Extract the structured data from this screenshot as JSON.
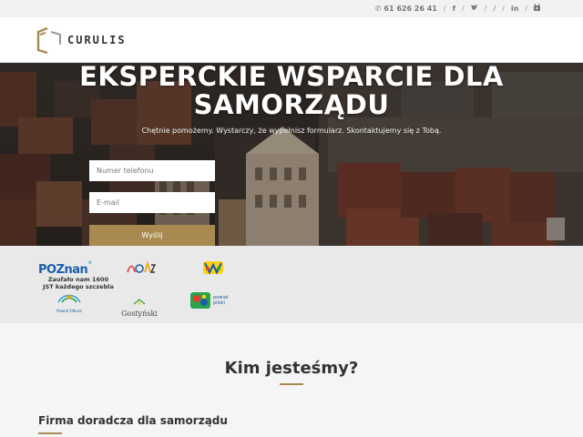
{
  "topbar": {
    "phone": "61 626 26 41",
    "separator": "/",
    "social": [
      {
        "icon": "facebook-icon",
        "glyph": "f"
      },
      {
        "icon": "twitter-icon",
        "glyph": "t"
      },
      {
        "icon": "google-plus-icon",
        "glyph": "/"
      },
      {
        "icon": "linkedin-icon",
        "glyph": "in"
      },
      {
        "icon": "youtube-icon",
        "glyph": "▶"
      }
    ]
  },
  "header": {
    "logo_text": "CURULIS"
  },
  "hero": {
    "title_line1": "EKSPERCKIE WSPARCIE DLA",
    "title_line2": "SAMORZĄDU",
    "subtitle": "Chętnie pomożemy. Wystarczy, że wypełnisz formularz. Skontaktujemy się z Tobą.",
    "phone_placeholder": "Numer telefonu",
    "email_placeholder": "E-mail",
    "send_label": "Wyślij"
  },
  "partners": {
    "poznan_logo": "POZnan",
    "trust_line1": "Zaufało nam 1600",
    "trust_line2": "JST każdego szczebla",
    "logos": [
      "Powiat Olkusz",
      "Gostyński",
      "powiat pilski"
    ]
  },
  "about": {
    "title": "Kim jesteśmy?",
    "subtitle": "Firma doradcza dla samorządu"
  },
  "colors": {
    "accent": "#a88a51",
    "text": "#333333"
  }
}
